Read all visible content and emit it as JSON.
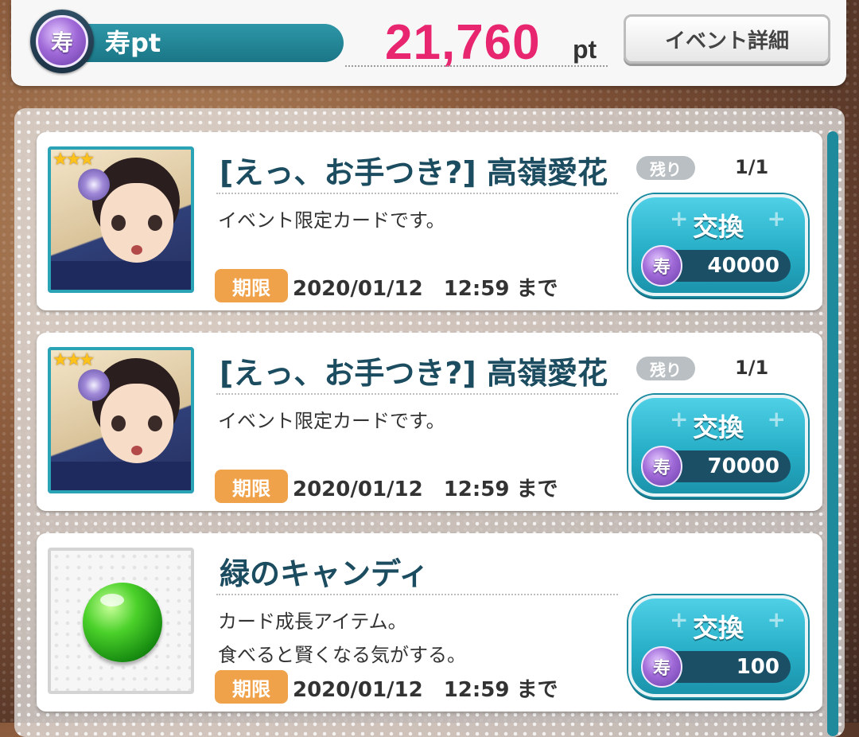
{
  "header": {
    "currency_icon": "寿",
    "currency_label": "寿pt",
    "points_value": "21,760",
    "points_unit": "pt",
    "event_detail_button": "イベント詳細"
  },
  "items": [
    {
      "title": "[えっ、お手つき?] 高嶺愛花",
      "remaining_label": "残り",
      "remaining_value": "1/1",
      "description": "イベント限定カードです。",
      "deadline_label": "期限",
      "deadline": "2020/01/12　12:59 まで",
      "exchange_label": "交換",
      "cost_icon": "寿",
      "cost": "40000",
      "rarity": "3-star"
    },
    {
      "title": "[えっ、お手つき?] 高嶺愛花",
      "remaining_label": "残り",
      "remaining_value": "1/1",
      "description": "イベント限定カードです。",
      "deadline_label": "期限",
      "deadline": "2020/01/12　12:59 まで",
      "exchange_label": "交換",
      "cost_icon": "寿",
      "cost": "70000",
      "rarity": "3-star"
    },
    {
      "title": "緑のキャンディ",
      "description_line1": "カード成長アイテム。",
      "description_line2": "食べると賢くなる気がする。",
      "deadline_label": "期限",
      "deadline": "2020/01/12　12:59 まで",
      "exchange_label": "交換",
      "cost_icon": "寿",
      "cost": "100"
    }
  ],
  "colors": {
    "points": "#e8266f",
    "accent": "#27afc7",
    "deadline": "#f0a24a",
    "title": "#1c4c60"
  }
}
